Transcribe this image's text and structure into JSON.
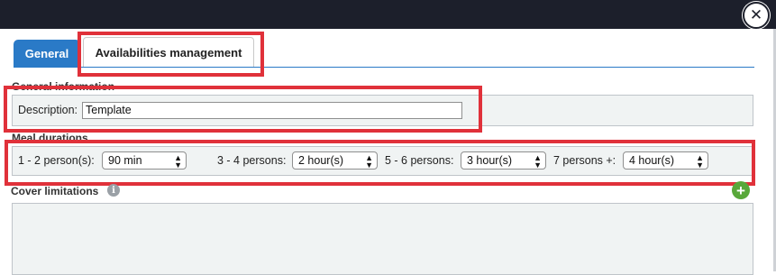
{
  "window": {
    "close_symbol": "✕",
    "close_icon": "close-icon"
  },
  "tabs": [
    {
      "label": "General",
      "active": true
    },
    {
      "label": "Availabilities management",
      "active": false
    }
  ],
  "general_information": {
    "title": "General information",
    "description_label": "Description:",
    "description_value": "Template"
  },
  "meal_durations": {
    "title": "Meal durations",
    "rows": [
      {
        "label": "1 - 2 person(s):",
        "value": "90 min"
      },
      {
        "label": "3 - 4 persons:",
        "value": "2 hour(s)"
      },
      {
        "label": "5 - 6 persons:",
        "value": "3 hour(s)"
      },
      {
        "label": "7 persons +:",
        "value": "4 hour(s)"
      }
    ]
  },
  "cover_limitations": {
    "title": "Cover limitations",
    "info_symbol": "i",
    "info_icon": "info-icon",
    "add_symbol": "+",
    "add_icon": "add-icon"
  },
  "colors": {
    "highlight": "#e0313a",
    "tab_active": "#2a7ac7",
    "add": "#58a83a",
    "topbar": "#1c1f2b"
  }
}
